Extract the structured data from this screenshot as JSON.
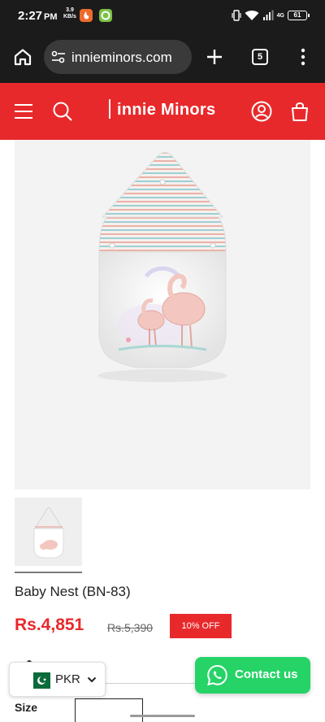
{
  "status_bar": {
    "time": "2:27",
    "ampm": "PM",
    "speed_value": "3.9",
    "speed_unit": "KB/s",
    "network": "4G",
    "battery": "61"
  },
  "browser": {
    "url": "innieminors.com",
    "tab_count": "5"
  },
  "site_header": {
    "logo_text": "innie Minors"
  },
  "product": {
    "title": "Baby Nest (BN-83)",
    "price": "Rs.4,851",
    "compare_price": "Rs.5,390",
    "discount_badge": "10% OFF",
    "option_label": "Size"
  },
  "currency_selector": {
    "currency": "PKR"
  },
  "contact_button": {
    "label": "Contact us"
  },
  "colors": {
    "brand_red": "#e8292b",
    "whatsapp_green": "#25d366",
    "browser_dark": "#1b1b1b"
  },
  "icons": [
    "home-icon",
    "site-settings-icon",
    "new-tab-icon",
    "tab-switcher-icon",
    "more-options-icon",
    "menu-icon",
    "search-icon",
    "account-icon",
    "cart-icon",
    "whatsapp-icon",
    "pakistan-flag-icon",
    "chevron-down-icon"
  ]
}
